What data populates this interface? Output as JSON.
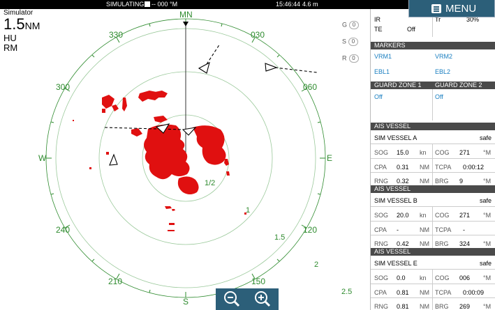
{
  "status_bar": {
    "mode": "SIMULATING...",
    "cog": "-- 000 °M",
    "time": "15:46:44",
    "depth": "4.6 m"
  },
  "menu": {
    "label": "MENU"
  },
  "radar": {
    "source": "Simulator",
    "range_value": "1.5",
    "range_unit": "NM",
    "orientation": "HU",
    "motion": "RM",
    "heading_label": "MN",
    "bearings": {
      "b330": "330",
      "b030": "030",
      "b300": "300",
      "b060": "060",
      "w": "W",
      "e": "E",
      "b240": "240",
      "b120": "120",
      "b210": "210",
      "b150": "150",
      "s": "S"
    },
    "ring_labels": {
      "r1": "1/2",
      "r2": "1",
      "r3": "1.5",
      "r4": "2",
      "r5": "2.5"
    },
    "controls": {
      "g": "G",
      "s": "S",
      "r": "R",
      "g_val": "0",
      "s_val": "0",
      "r_val": "0"
    }
  },
  "panel": {
    "ir": {
      "label": "IR",
      "value": ""
    },
    "te": {
      "label": "TE",
      "value": "Off"
    },
    "tr": {
      "label": "Tr",
      "value": "30%"
    },
    "markers": {
      "header": "MARKERS",
      "vrm1": "VRM1",
      "vrm2": "VRM2",
      "ebl1": "EBL1",
      "ebl2": "EBL2"
    },
    "guard": {
      "h1": "GUARD ZONE 1",
      "h2": "GUARD ZONE 2",
      "v1": "Off",
      "v2": "Off"
    },
    "vessels": [
      {
        "header": "AIS VESSEL",
        "name": "SIM VESSEL A",
        "state": "safe",
        "sog": "15.0",
        "sog_u": "kn",
        "cog": "271",
        "cog_u": "°M",
        "cpa": "0.31",
        "cpa_u": "NM",
        "tcpa": "0:00:12",
        "rng": "0.32",
        "rng_u": "NM",
        "brg": "9",
        "brg_u": "°M"
      },
      {
        "header": "AIS VESSEL",
        "name": "SIM VESSEL B",
        "state": "safe",
        "sog": "20.0",
        "sog_u": "kn",
        "cog": "271",
        "cog_u": "°M",
        "cpa": "-",
        "cpa_u": "NM",
        "tcpa": "-",
        "rng": "0.42",
        "rng_u": "NM",
        "brg": "324",
        "brg_u": "°M"
      },
      {
        "header": "AIS VESSEL",
        "name": "SIM VESSEL E",
        "state": "safe",
        "sog": "0.0",
        "sog_u": "kn",
        "cog": "006",
        "cog_u": "°M",
        "cpa": "0.81",
        "cpa_u": "NM",
        "tcpa": "0:00:09",
        "rng": "0.81",
        "rng_u": "NM",
        "brg": "269",
        "brg_u": "°M"
      }
    ],
    "labels": {
      "sog": "SOG",
      "cog": "COG",
      "cpa": "CPA",
      "tcpa": "TCPA",
      "rng": "RNG",
      "brg": "BRG"
    }
  },
  "colors": {
    "ring": "#2e8b2e",
    "echo": "#e01010",
    "accent": "#2c5f79",
    "header": "#4a4a4a",
    "link": "#1a7fc1"
  }
}
